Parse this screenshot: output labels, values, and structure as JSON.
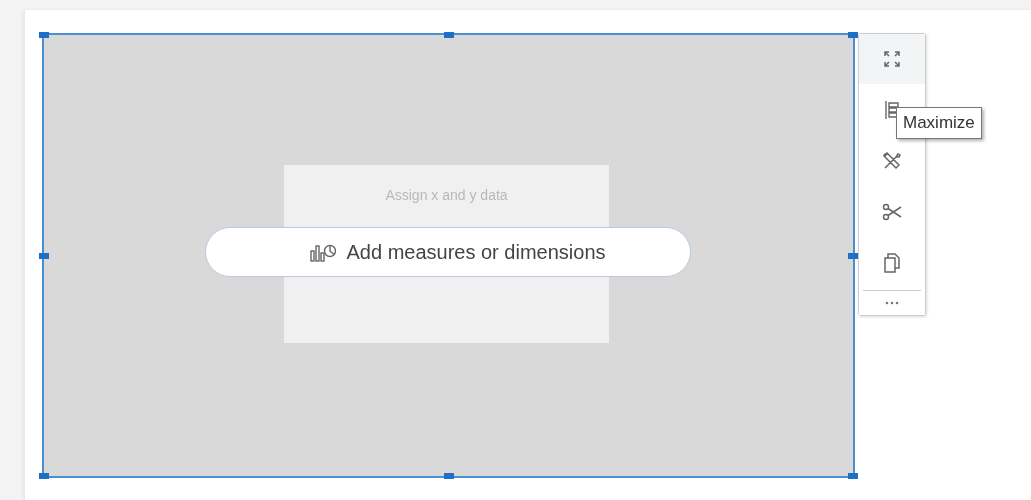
{
  "visual": {
    "selected": true,
    "placeholder": "Assign x and y data",
    "add_button": "Add measures or dimensions"
  },
  "toolbar": {
    "items": [
      {
        "kind": "focus",
        "hovered": true
      },
      {
        "kind": "fields",
        "hovered": false
      },
      {
        "kind": "format",
        "hovered": false
      },
      {
        "kind": "cut",
        "hovered": false
      },
      {
        "kind": "copy",
        "hovered": false
      }
    ],
    "more": true
  },
  "tooltip": "Maximize"
}
